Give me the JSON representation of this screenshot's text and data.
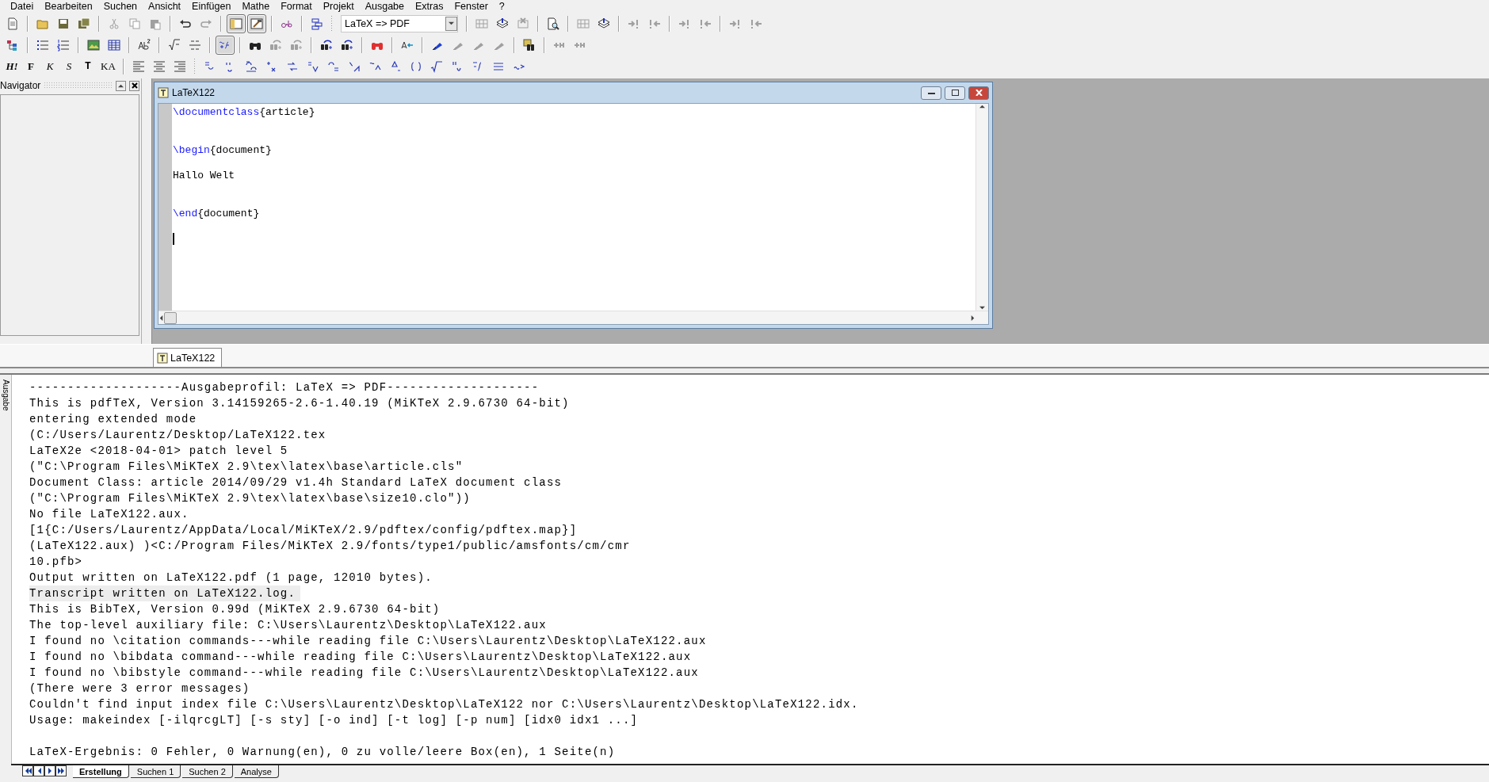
{
  "menu": [
    {
      "label": "Datei"
    },
    {
      "label": "Bearbeiten"
    },
    {
      "label": "Suchen"
    },
    {
      "label": "Ansicht"
    },
    {
      "label": "Einfügen"
    },
    {
      "label": "Mathe"
    },
    {
      "label": "Format"
    },
    {
      "label": "Projekt"
    },
    {
      "label": "Ausgabe"
    },
    {
      "label": "Extras"
    },
    {
      "label": "Fenster"
    },
    {
      "label": "?"
    }
  ],
  "toolbar_1": {
    "groups": [
      [
        {
          "disabled": false,
          "pressed": false
        }
      ],
      [
        {
          "disabled": false,
          "pressed": false
        },
        {
          "disabled": false,
          "pressed": false
        },
        {
          "disabled": false,
          "pressed": false
        }
      ],
      [
        {
          "disabled": true,
          "pressed": false
        },
        {
          "disabled": true,
          "pressed": false
        },
        {
          "disabled": true,
          "pressed": false
        }
      ],
      [
        {
          "disabled": false,
          "pressed": false
        },
        {
          "disabled": true,
          "pressed": false
        }
      ],
      [
        {
          "disabled": false,
          "pressed": true
        },
        {
          "disabled": false,
          "pressed": true
        }
      ],
      [
        {
          "disabled": false,
          "pressed": false
        }
      ],
      [
        {
          "disabled": false,
          "pressed": false
        }
      ]
    ],
    "profile": {
      "value": "LaTeX => PDF"
    },
    "groups_after": [
      [
        {
          "disabled": true,
          "pressed": false
        },
        {
          "disabled": false,
          "pressed": false
        },
        {
          "disabled": true,
          "pressed": false
        }
      ],
      [
        {
          "disabled": false,
          "pressed": false
        }
      ],
      [
        {
          "disabled": true,
          "pressed": false
        },
        {
          "disabled": false,
          "pressed": false
        }
      ],
      [
        {
          "disabled": true,
          "pressed": false
        },
        {
          "disabled": true,
          "pressed": false
        }
      ],
      [
        {
          "disabled": true,
          "pressed": false
        },
        {
          "disabled": true,
          "pressed": false
        }
      ],
      [
        {
          "disabled": true,
          "pressed": false
        },
        {
          "disabled": true,
          "pressed": false
        }
      ]
    ]
  },
  "toolbar_2": {
    "groups": [
      [
        {
          "disabled": false,
          "pressed": false
        }
      ],
      [
        {
          "disabled": false,
          "pressed": false
        },
        {
          "disabled": false,
          "pressed": false
        }
      ],
      [
        {
          "disabled": false,
          "pressed": false
        },
        {
          "disabled": false,
          "pressed": false
        }
      ],
      [
        {
          "disabled": false,
          "pressed": false
        }
      ],
      [
        {
          "disabled": false,
          "pressed": false
        },
        {
          "disabled": false,
          "pressed": false
        }
      ],
      [
        {
          "disabled": false,
          "pressed": true
        }
      ],
      [
        {
          "disabled": false,
          "pressed": false
        },
        {
          "disabled": true,
          "pressed": false
        },
        {
          "disabled": true,
          "pressed": false
        }
      ],
      [
        {
          "disabled": false,
          "pressed": false
        },
        {
          "disabled": false,
          "pressed": false
        }
      ],
      [
        {
          "disabled": false,
          "pressed": false
        }
      ],
      [
        {
          "disabled": false,
          "pressed": false
        }
      ],
      [
        {
          "disabled": false,
          "pressed": false
        },
        {
          "disabled": true,
          "pressed": false
        },
        {
          "disabled": true,
          "pressed": false
        },
        {
          "disabled": true,
          "pressed": false
        }
      ],
      [
        {
          "disabled": false,
          "pressed": false
        }
      ],
      [
        {
          "disabled": true,
          "pressed": false
        },
        {
          "disabled": true,
          "pressed": false
        }
      ]
    ]
  },
  "toolbar_3": {
    "format_buttons": [
      {
        "label": "H!",
        "kind": "bolditalic"
      },
      {
        "label": "F",
        "kind": "bold"
      },
      {
        "label": "K",
        "kind": "italic"
      },
      {
        "label": "S",
        "kind": "slanted"
      },
      {
        "label": "T",
        "kind": "typewriter"
      },
      {
        "label": "KA",
        "kind": "smallcaps"
      }
    ],
    "align_buttons": [
      {
        "disabled": false
      },
      {
        "disabled": false
      },
      {
        "disabled": false
      }
    ],
    "math_buttons": [
      {
        "disabled": false
      },
      {
        "disabled": false
      },
      {
        "disabled": false
      },
      {
        "disabled": false
      },
      {
        "disabled": false
      },
      {
        "disabled": false
      },
      {
        "disabled": false
      },
      {
        "disabled": false
      },
      {
        "disabled": false
      },
      {
        "disabled": false
      },
      {
        "disabled": false
      },
      {
        "disabled": false
      },
      {
        "disabled": false
      },
      {
        "disabled": false
      },
      {
        "disabled": false
      },
      {
        "disabled": false
      }
    ]
  },
  "navigator": {
    "title": "Navigator"
  },
  "editor": {
    "title": "LaTeX122",
    "lines": [
      {
        "kind": "code",
        "segments": [
          {
            "text": "\\documentclass",
            "kind": "command"
          },
          {
            "text": "{article}",
            "kind": "plain"
          }
        ]
      },
      {
        "kind": "blank"
      },
      {
        "kind": "blank"
      },
      {
        "kind": "code",
        "segments": [
          {
            "text": "\\begin",
            "kind": "command"
          },
          {
            "text": "{document}",
            "kind": "plain"
          }
        ]
      },
      {
        "kind": "blank"
      },
      {
        "kind": "code",
        "segments": [
          {
            "text": "Hallo Welt",
            "kind": "plain"
          }
        ]
      },
      {
        "kind": "blank"
      },
      {
        "kind": "blank"
      },
      {
        "kind": "code",
        "segments": [
          {
            "text": "\\end",
            "kind": "command"
          },
          {
            "text": "{document}",
            "kind": "plain"
          }
        ]
      },
      {
        "kind": "blank"
      },
      {
        "kind": "cursor"
      }
    ]
  },
  "document_tabs": [
    {
      "label": "LaTeX122",
      "selected": true
    }
  ],
  "output": {
    "side_label": "Ausgabe",
    "lines": [
      {
        "kind": "text",
        "text": "--------------------Ausgabeprofil: LaTeX => PDF--------------------",
        "highlighted": false
      },
      {
        "kind": "text",
        "text": "This is pdfTeX, Version 3.14159265-2.6-1.40.19 (MiKTeX 2.9.6730 64-bit)",
        "highlighted": false
      },
      {
        "kind": "text",
        "text": "entering extended mode",
        "highlighted": false
      },
      {
        "kind": "text",
        "text": "(C:/Users/Laurentz/Desktop/LaTeX122.tex",
        "highlighted": false
      },
      {
        "kind": "text",
        "text": "LaTeX2e <2018-04-01> patch level 5",
        "highlighted": false
      },
      {
        "kind": "text",
        "text": "(\"C:\\Program Files\\MiKTeX 2.9\\tex\\latex\\base\\article.cls\"",
        "highlighted": false
      },
      {
        "kind": "text",
        "text": "Document Class: article 2014/09/29 v1.4h Standard LaTeX document class",
        "highlighted": false
      },
      {
        "kind": "text",
        "text": "(\"C:\\Program Files\\MiKTeX 2.9\\tex\\latex\\base\\size10.clo\"))",
        "highlighted": false
      },
      {
        "kind": "text",
        "text": "No file LaTeX122.aux.",
        "highlighted": false
      },
      {
        "kind": "text",
        "text": "[1{C:/Users/Laurentz/AppData/Local/MiKTeX/2.9/pdftex/config/pdftex.map}]",
        "highlighted": false
      },
      {
        "kind": "text",
        "text": "(LaTeX122.aux) )<C:/Program Files/MiKTeX 2.9/fonts/type1/public/amsfonts/cm/cmr",
        "highlighted": false
      },
      {
        "kind": "text",
        "text": "10.pfb>",
        "highlighted": false
      },
      {
        "kind": "text",
        "text": "Output written on LaTeX122.pdf (1 page, 12010 bytes).",
        "highlighted": false
      },
      {
        "kind": "text",
        "text": "Transcript written on LaTeX122.log.",
        "highlighted": true
      },
      {
        "kind": "text",
        "text": "This is BibTeX, Version 0.99d (MiKTeX 2.9.6730 64-bit)",
        "highlighted": false
      },
      {
        "kind": "text",
        "text": "The top-level auxiliary file: C:\\Users\\Laurentz\\Desktop\\LaTeX122.aux",
        "highlighted": false
      },
      {
        "kind": "text",
        "text": "I found no \\citation commands---while reading file C:\\Users\\Laurentz\\Desktop\\LaTeX122.aux",
        "highlighted": false
      },
      {
        "kind": "text",
        "text": "I found no \\bibdata command---while reading file C:\\Users\\Laurentz\\Desktop\\LaTeX122.aux",
        "highlighted": false
      },
      {
        "kind": "text",
        "text": "I found no \\bibstyle command---while reading file C:\\Users\\Laurentz\\Desktop\\LaTeX122.aux",
        "highlighted": false
      },
      {
        "kind": "text",
        "text": "(There were 3 error messages)",
        "highlighted": false
      },
      {
        "kind": "text",
        "text": "Couldn't find input index file C:\\Users\\Laurentz\\Desktop\\LaTeX122 nor C:\\Users\\Laurentz\\Desktop\\LaTeX122.idx.",
        "highlighted": false
      },
      {
        "kind": "text",
        "text": "Usage: makeindex [-ilqrcgLT] [-s sty] [-o ind] [-t log] [-p num] [idx0 idx1 ...]",
        "highlighted": false
      },
      {
        "kind": "blank"
      },
      {
        "kind": "text",
        "text": "LaTeX-Ergebnis: 0 Fehler, 0 Warnung(en), 0 zu volle/leere Box(en), 1 Seite(n)",
        "highlighted": false
      }
    ],
    "tabs": [
      {
        "label": "Erstellung",
        "selected": true
      },
      {
        "label": "Suchen 1",
        "selected": false
      },
      {
        "label": "Suchen 2",
        "selected": false
      },
      {
        "label": "Analyse",
        "selected": false
      }
    ]
  }
}
